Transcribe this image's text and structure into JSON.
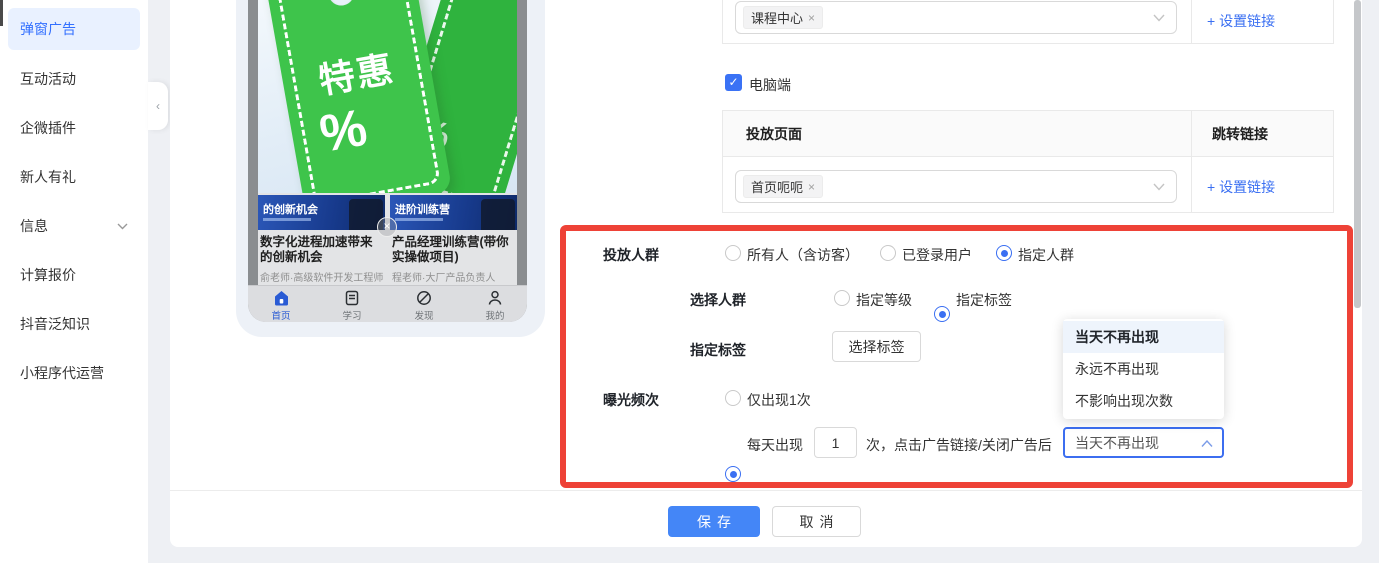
{
  "icons": {
    "close": "×",
    "check": "✓",
    "collapse": "‹"
  },
  "sidebar": {
    "items": [
      {
        "label": "弹窗广告",
        "active": true
      },
      {
        "label": "互动活动"
      },
      {
        "label": "企微插件"
      },
      {
        "label": "新人有礼"
      },
      {
        "label": "信息"
      },
      {
        "label": "计算报价"
      },
      {
        "label": "抖音泛知识"
      },
      {
        "label": "小程序代运营"
      }
    ]
  },
  "phone": {
    "promo": {
      "tag_text": "特惠",
      "percent": "%"
    },
    "courses": [
      {
        "banner": "的创新机会",
        "title": "数字化进程加速带来的创新机会",
        "teacher": "俞老师·高级软件开发工程师"
      },
      {
        "banner": "进阶训练营",
        "title": "产品经理训练营(带你实操做项目)",
        "teacher": "程老师·大厂产品负责人"
      }
    ],
    "tabs": [
      {
        "label": "首页",
        "active": true
      },
      {
        "label": "学习"
      },
      {
        "label": "发现"
      },
      {
        "label": "我的"
      }
    ]
  },
  "form": {
    "top_select": {
      "tag": "课程中心",
      "link": "+ 设置链接"
    },
    "pc_checkbox": {
      "label": "电脑端",
      "checked": true
    },
    "table": {
      "col1": "投放页面",
      "col2": "跳转链接",
      "row_tag": "首页呃呃",
      "row_link": "+ 设置链接"
    },
    "audience": {
      "label": "投放人群",
      "opt1": "所有人（含访客）",
      "opt2": "已登录用户",
      "opt3": "指定人群"
    },
    "group": {
      "label": "选择人群",
      "opt1": "指定等级",
      "opt2": "指定标签"
    },
    "tag_row": {
      "label": "指定标签",
      "button": "选择标签"
    },
    "frequency": {
      "label": "曝光频次",
      "opt1": "仅出现1次",
      "opt2_prefix": "每天出现",
      "times_value": "1",
      "opt2_suffix": "次，点击广告链接/关闭广告后",
      "select_value": "当天不再出现"
    },
    "dropdown": {
      "opt1": "当天不再出现",
      "opt2": "永远不再出现",
      "opt3": "不影响出现次数"
    },
    "footer": {
      "save": "保存",
      "cancel": "取消"
    }
  }
}
